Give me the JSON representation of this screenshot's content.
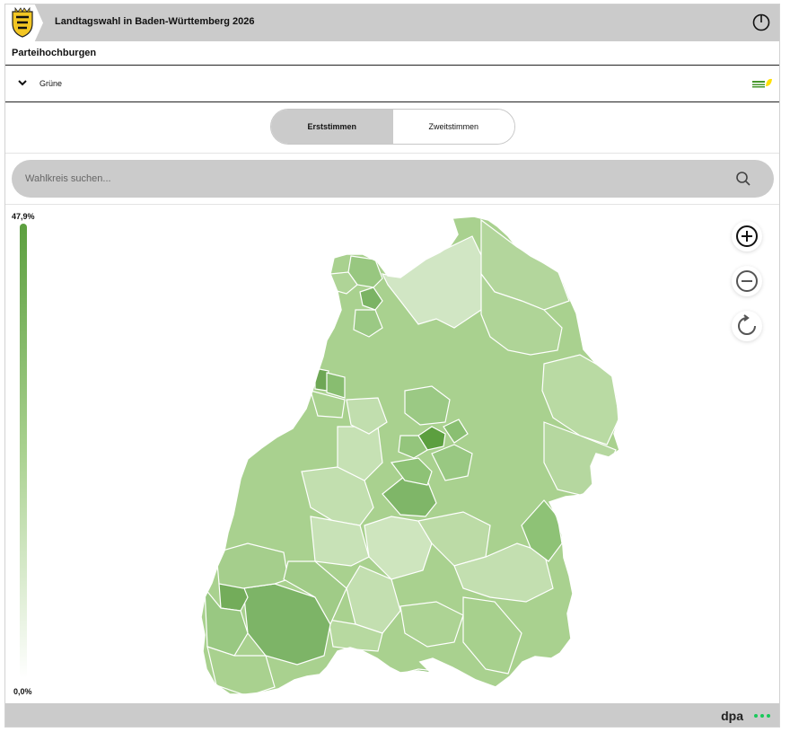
{
  "header": {
    "title": "Landtagswahl in Baden-Württemberg 2026",
    "power_icon": "power-icon",
    "crest_icon": "coat-of-arms-icon"
  },
  "section_title": "Parteihochburgen",
  "party_select": {
    "selected": "Grüne",
    "logo_icon": "gruene-logo-icon",
    "chevron_icon": "chevron-down-icon"
  },
  "vote_toggle": {
    "options": [
      "Erststimmen",
      "Zweitstimmen"
    ],
    "active": "Erststimmen"
  },
  "search": {
    "placeholder": "Wahlkreis suchen...",
    "icon": "search-icon"
  },
  "legend": {
    "max_label": "47,9%",
    "min_label": "0,0%",
    "color_high": "#5c9f3f",
    "color_low": "#ffffff"
  },
  "map_controls": {
    "zoom_in_icon": "zoom-in-icon",
    "zoom_out_icon": "zoom-out-icon",
    "reset_icon": "reset-icon"
  },
  "colors": {
    "header_bg": "#cbcbcb",
    "map_dark": "#5c9f3f",
    "map_mid": "#a9d18f",
    "map_light": "#d1e6c4"
  },
  "footer": {
    "brand": "dpa",
    "brand_dots_color": "#19c95a"
  }
}
